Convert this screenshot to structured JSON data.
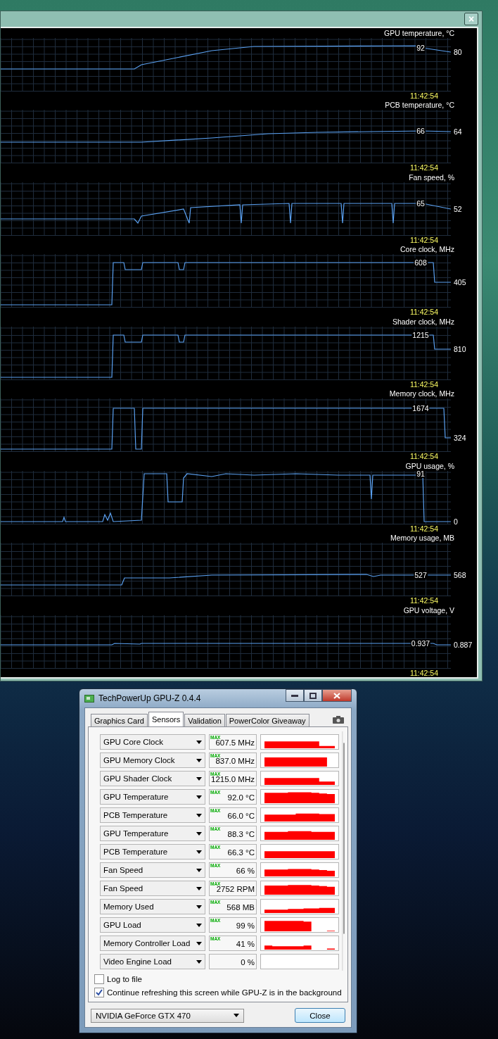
{
  "graph_window": {
    "close": "×",
    "graphs": [
      {
        "title": "GPU temperature, °C",
        "max": "92",
        "current": "80",
        "time": "11:42:54"
      },
      {
        "title": "PCB temperature, °C",
        "max": "66",
        "current": "64",
        "time": "11:42:54"
      },
      {
        "title": "Fan speed, %",
        "max": "65",
        "current": "52",
        "time": "11:42:54"
      },
      {
        "title": "Core clock, MHz",
        "max": "608",
        "current": "405",
        "time": "11:42:54"
      },
      {
        "title": "Shader clock, MHz",
        "max": "1215",
        "current": "810",
        "time": "11:42:54"
      },
      {
        "title": "Memory clock, MHz",
        "max": "1674",
        "current": "324",
        "time": "11:42:54"
      },
      {
        "title": "GPU usage, %",
        "max": "91",
        "current": "0",
        "time": "11:42:54"
      },
      {
        "title": "Memory usage, MB",
        "max": "527",
        "current": "568",
        "time": "11:42:54"
      },
      {
        "title": "GPU voltage, V",
        "max": "0.937",
        "current": "0.887",
        "time": "11:42:54"
      }
    ]
  },
  "gpuz": {
    "title": "TechPowerUp GPU-Z 0.4.4",
    "tabs": [
      {
        "label": "Graphics Card",
        "selected": false
      },
      {
        "label": "Sensors",
        "selected": true
      },
      {
        "label": "Validation",
        "selected": false
      },
      {
        "label": "PowerColor Giveaway",
        "selected": false
      }
    ],
    "sensors": [
      {
        "name": "GPU Core Clock",
        "badge": "MAX",
        "value": "607.5 MHz"
      },
      {
        "name": "GPU Memory Clock",
        "badge": "MAX",
        "value": "837.0 MHz"
      },
      {
        "name": "GPU Shader Clock",
        "badge": "MAX",
        "value": "1215.0 MHz"
      },
      {
        "name": "GPU Temperature",
        "badge": "MAX",
        "value": "92.0 °C"
      },
      {
        "name": "PCB Temperature",
        "badge": "MAX",
        "value": "66.0 °C"
      },
      {
        "name": "GPU Temperature",
        "badge": "MAX",
        "value": "88.3 °C"
      },
      {
        "name": "PCB Temperature",
        "badge": "MAX",
        "value": "66.3 °C"
      },
      {
        "name": "Fan Speed",
        "badge": "MAX",
        "value": "66 %"
      },
      {
        "name": "Fan Speed",
        "badge": "MAX",
        "value": "2752 RPM"
      },
      {
        "name": "Memory Used",
        "badge": "MAX",
        "value": "568 MB"
      },
      {
        "name": "GPU Load",
        "badge": "MAX",
        "value": "99 %"
      },
      {
        "name": "Memory Controller Load",
        "badge": "MAX",
        "value": "41 %"
      },
      {
        "name": "Video Engine Load",
        "value": "0 %"
      }
    ],
    "options": [
      {
        "label": "Log to file",
        "checked": false
      },
      {
        "label": "Continue refreshing this screen while GPU-Z is in the background",
        "checked": true
      }
    ],
    "card": "NVIDIA GeForce GTX 470",
    "close": "Close"
  }
}
